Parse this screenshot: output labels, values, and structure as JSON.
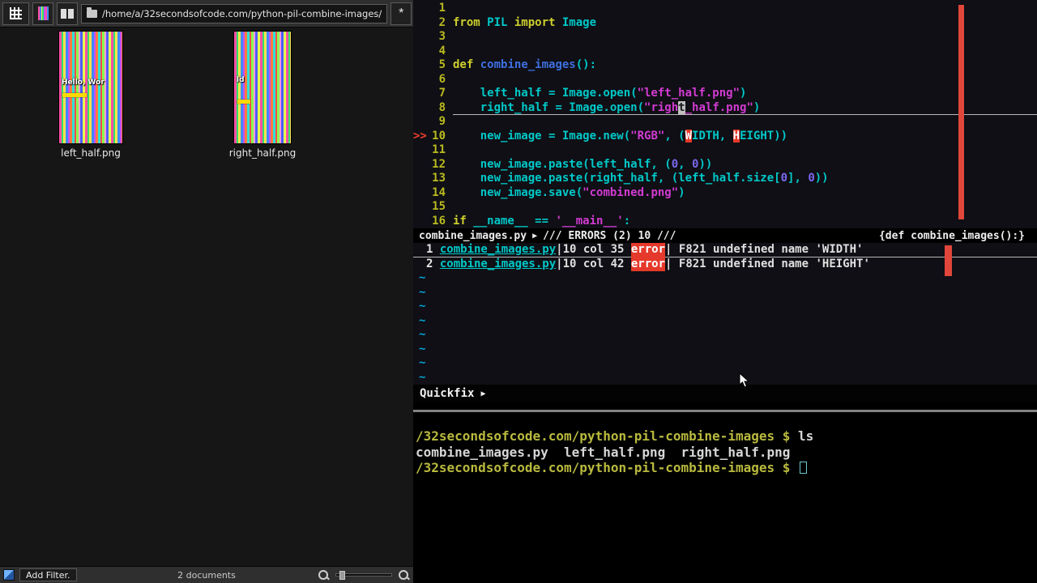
{
  "icons": {
    "star": "*",
    "check": "✓",
    "green_grid": "▦",
    "arrow_right": "▶"
  },
  "file_manager": {
    "toolbar": {
      "path": "/home/a/32secondsofcode.com/python-pil-combine-images/"
    },
    "files": [
      {
        "label": "left_half.png",
        "overlay": "Hello, Wor"
      },
      {
        "label": "right_half.png",
        "overlay": "ld"
      }
    ],
    "statusbar": {
      "filter_button": "Add Filter.",
      "count_label": "2 documents"
    }
  },
  "editor": {
    "code_lines": [
      {
        "num": "1",
        "tokens": []
      },
      {
        "num": "2",
        "tokens": [
          {
            "t": "from",
            "c": "k"
          },
          {
            "t": " PIL ",
            "c": "n"
          },
          {
            "t": "import",
            "c": "k"
          },
          {
            "t": " Image",
            "c": "n"
          }
        ]
      },
      {
        "num": "3",
        "tokens": []
      },
      {
        "num": "4",
        "tokens": []
      },
      {
        "num": "5",
        "tokens": [
          {
            "t": "def",
            "c": "k"
          },
          {
            "t": " ",
            "c": "n"
          },
          {
            "t": "combine_images",
            "c": "f"
          },
          {
            "t": "():",
            "c": "n"
          }
        ]
      },
      {
        "num": "6",
        "tokens": []
      },
      {
        "num": "7",
        "tokens": [
          {
            "t": "    left_half = Image.open(",
            "c": "n"
          },
          {
            "t": "\"left_half.png\"",
            "c": "s"
          },
          {
            "t": ")",
            "c": "n"
          }
        ]
      },
      {
        "num": "8",
        "cursor_line": true,
        "tokens": [
          {
            "t": "    right_half = Image.open(",
            "c": "n"
          },
          {
            "t": "\"righ",
            "c": "s"
          },
          {
            "t": "t",
            "c": "cur"
          },
          {
            "t": "_half.png\"",
            "c": "s"
          },
          {
            "t": ")",
            "c": "n"
          }
        ]
      },
      {
        "num": "9",
        "tokens": []
      },
      {
        "num": "10",
        "sign": ">>",
        "tokens": [
          {
            "t": "    new_image = Image.new(",
            "c": "n"
          },
          {
            "t": "\"RGB\"",
            "c": "s"
          },
          {
            "t": ", (",
            "c": "n"
          },
          {
            "t": "W",
            "c": "e"
          },
          {
            "t": "IDTH, ",
            "c": "n"
          },
          {
            "t": "H",
            "c": "e"
          },
          {
            "t": "EIGHT))",
            "c": "n"
          }
        ]
      },
      {
        "num": "11",
        "tokens": []
      },
      {
        "num": "12",
        "tokens": [
          {
            "t": "    new_image.paste(left_half, (",
            "c": "n"
          },
          {
            "t": "0",
            "c": "d"
          },
          {
            "t": ", ",
            "c": "n"
          },
          {
            "t": "0",
            "c": "d"
          },
          {
            "t": "))",
            "c": "n"
          }
        ]
      },
      {
        "num": "13",
        "tokens": [
          {
            "t": "    new_image.paste(right_half, (left_half.size[",
            "c": "n"
          },
          {
            "t": "0",
            "c": "d"
          },
          {
            "t": "], ",
            "c": "n"
          },
          {
            "t": "0",
            "c": "d"
          },
          {
            "t": "))",
            "c": "n"
          }
        ]
      },
      {
        "num": "14",
        "tokens": [
          {
            "t": "    new_image.save(",
            "c": "n"
          },
          {
            "t": "\"combined.png\"",
            "c": "s"
          },
          {
            "t": ")",
            "c": "n"
          }
        ]
      },
      {
        "num": "15",
        "tokens": []
      },
      {
        "num": "16",
        "tokens": [
          {
            "t": "if",
            "c": "k"
          },
          {
            "t": " __name__ == ",
            "c": "n"
          },
          {
            "t": "'__main__'",
            "c": "s"
          },
          {
            "t": ":",
            "c": "n"
          }
        ]
      }
    ],
    "statusline": {
      "file": "combine_images.py",
      "arrow": "▶",
      "errors": "/// ERRORS (2)  10 ///",
      "right": "{def combine_images():}"
    },
    "quickfix": [
      {
        "idx": "1",
        "file": "combine_images.py",
        "loc": "10 col 35",
        "type": "error",
        "msg": "F821 undefined name 'WIDTH'",
        "selected": true
      },
      {
        "idx": "2",
        "file": "combine_images.py",
        "loc": "10 col 42",
        "type": "error",
        "msg": "F821 undefined name 'HEIGHT'",
        "selected": false
      }
    ],
    "tilde_char": "~",
    "tilde_count": 8,
    "quickfix_bar": {
      "label": "Quickfix",
      "arrow": "▶"
    }
  },
  "terminal": {
    "lines": [
      {
        "prompt": "/32secondsofcode.com/python-pil-combine-images $",
        "cmd": "ls"
      },
      {
        "output": "combine_images.py  left_half.png  right_half.png"
      },
      {
        "prompt": "/32secondsofcode.com/python-pil-combine-images $",
        "cmd": "",
        "cursor": true
      }
    ]
  }
}
